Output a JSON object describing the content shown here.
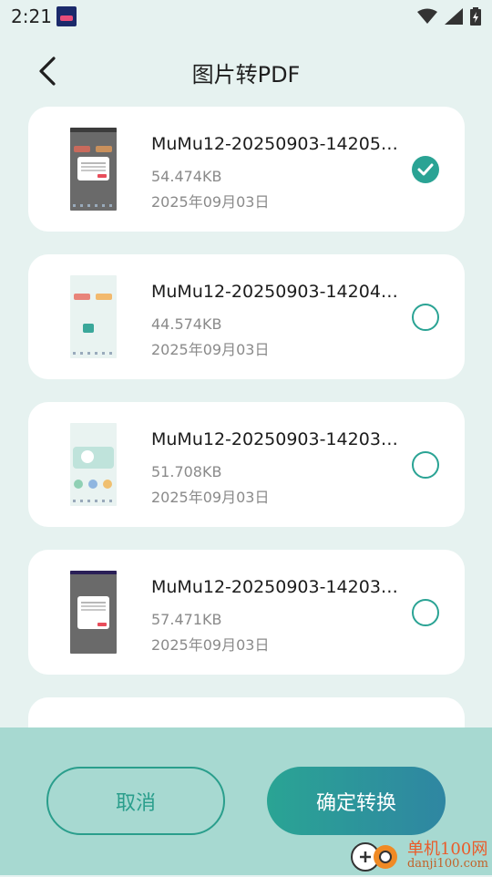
{
  "status_bar": {
    "time": "2:21",
    "icons": [
      "app-notification-icon",
      "wifi-icon",
      "cellular-signal-icon",
      "battery-charging-icon"
    ]
  },
  "header": {
    "title": "图片转PDF",
    "back_icon": "back-arrow-icon"
  },
  "files": [
    {
      "name": "MuMu12-20250903-14205…",
      "size": "54.474KB",
      "date": "2025年09月03日",
      "selected": true
    },
    {
      "name": "MuMu12-20250903-14204…",
      "size": "44.574KB",
      "date": "2025年09月03日",
      "selected": false
    },
    {
      "name": "MuMu12-20250903-14203…",
      "size": "51.708KB",
      "date": "2025年09月03日",
      "selected": false
    },
    {
      "name": "MuMu12-20250903-14203…",
      "size": "57.471KB",
      "date": "2025年09月03日",
      "selected": false
    }
  ],
  "actions": {
    "cancel_label": "取消",
    "confirm_label": "确定转换"
  },
  "watermark": {
    "main": "单机100网",
    "sub": "danji100.com"
  },
  "colors": {
    "accent": "#2aa394",
    "background": "#e6f2f0",
    "bottom_bar": "#a7d9d1"
  }
}
